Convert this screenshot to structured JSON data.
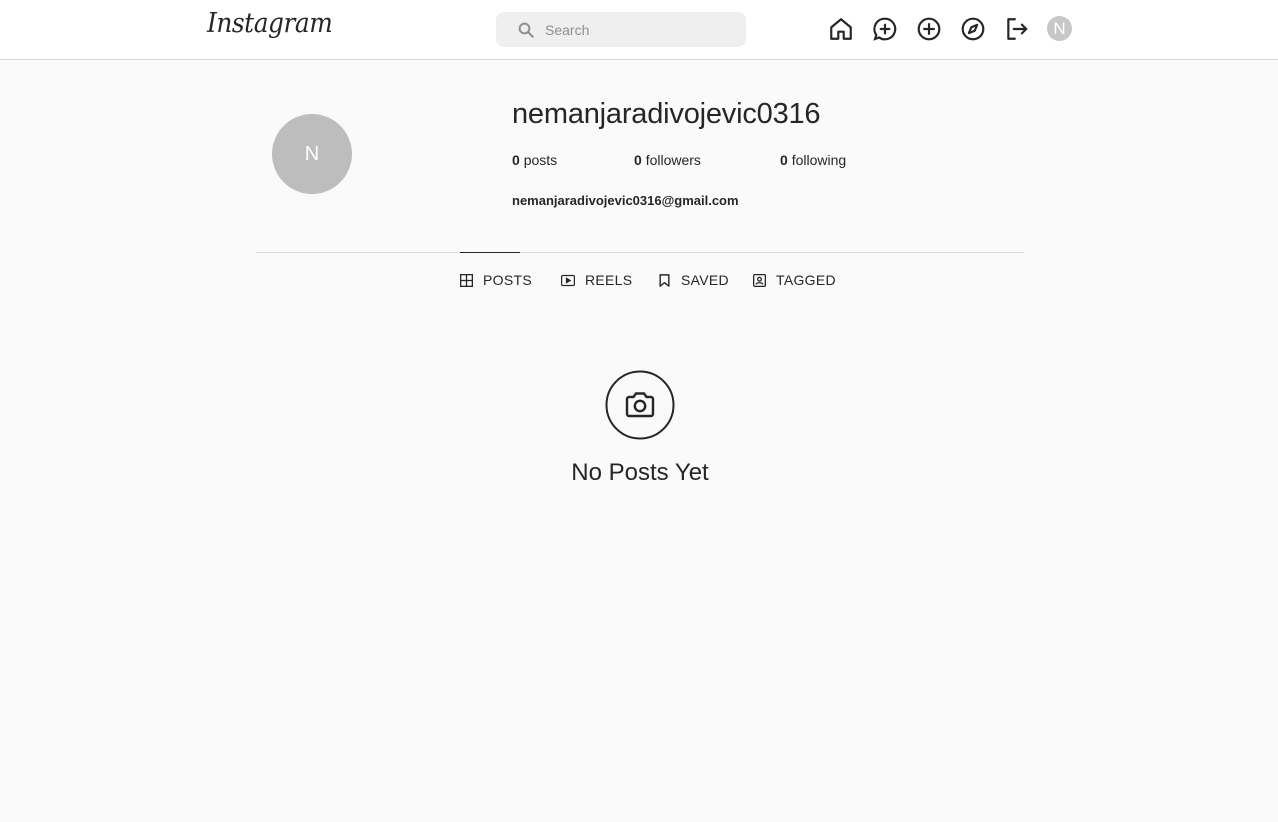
{
  "header": {
    "logo_text": "Instagram",
    "search": {
      "placeholder": "Search",
      "value": ""
    },
    "nav_icons": [
      "home-icon",
      "messenger-icon",
      "new-post-icon",
      "explore-icon",
      "logout-icon"
    ],
    "avatar_initial": "N"
  },
  "profile": {
    "avatar_initial": "N",
    "username": "nemanjaradivojevic0316",
    "stats": {
      "posts_count": "0",
      "posts_label": "posts",
      "followers_count": "0",
      "followers_label": "followers",
      "following_count": "0",
      "following_label": "following"
    },
    "email": "nemanjaradivojevic0316@gmail.com"
  },
  "tabs": [
    {
      "label": "POSTS",
      "icon": "grid-icon",
      "active": true
    },
    {
      "label": "REELS",
      "icon": "reels-icon",
      "active": false
    },
    {
      "label": "SAVED",
      "icon": "bookmark-icon",
      "active": false
    },
    {
      "label": "TAGGED",
      "icon": "tagged-icon",
      "active": false
    }
  ],
  "empty_state": {
    "icon": "camera-icon",
    "title": "No Posts Yet"
  },
  "colors": {
    "background": "#fafafa",
    "text": "#262626",
    "border": "#dbdbdb",
    "avatar": "#bdbdbd"
  }
}
